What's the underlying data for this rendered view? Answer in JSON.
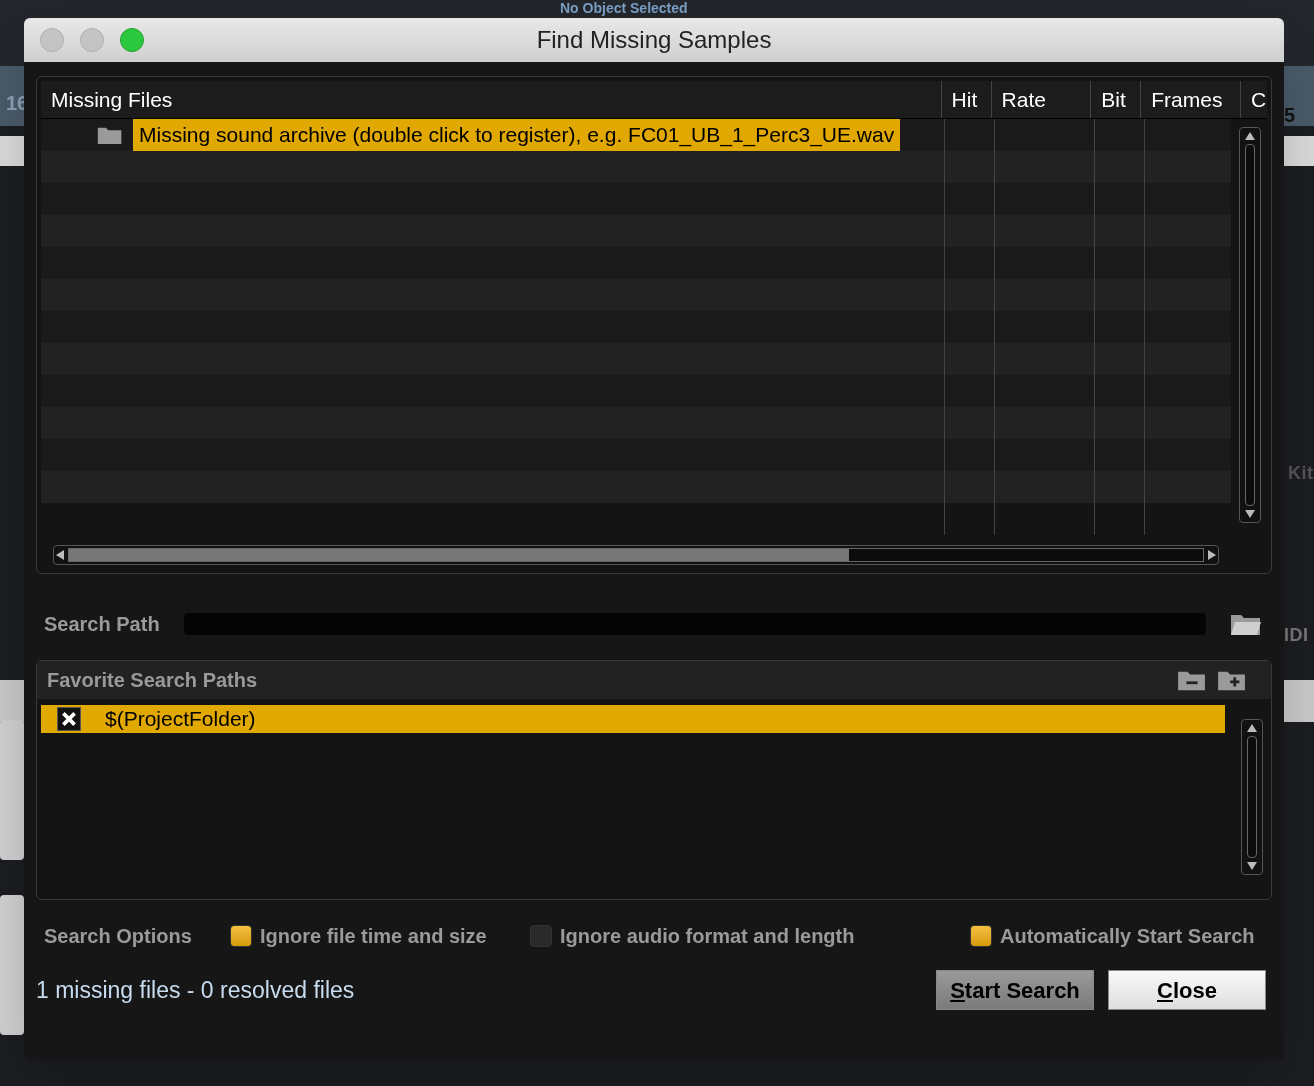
{
  "background": {
    "header_title": "No Object Selected",
    "fragments": [
      {
        "kind": "number",
        "text": "16"
      },
      {
        "kind": "number",
        "text": "5"
      },
      {
        "kind": "label",
        "text": "Kit"
      },
      {
        "kind": "label",
        "text": "IDI"
      }
    ]
  },
  "window": {
    "title": "Find Missing Samples"
  },
  "missing_files": {
    "columns": [
      "Missing Files",
      "Hit",
      "Rate",
      "Bit",
      "Frames",
      "C"
    ],
    "rows": [
      {
        "name": "Missing sound archive (double click to register), e.g. FC01_UB_1_Perc3_UE.wav",
        "selected": true
      }
    ]
  },
  "search_path": {
    "label": "Search Path"
  },
  "favorites": {
    "title": "Favorite Search Paths",
    "items": [
      {
        "path": "$(ProjectFolder)",
        "checked": true,
        "selected": true
      }
    ]
  },
  "search_options": {
    "label": "Search Options",
    "options": [
      {
        "label": "Ignore file time and size",
        "checked": true
      },
      {
        "label": "Ignore audio format and length",
        "checked": false
      },
      {
        "label": "Automatically Start Search",
        "checked": true
      }
    ]
  },
  "status": "1 missing files - 0 resolved files",
  "buttons": [
    {
      "mnemonic": "S",
      "rest": "tart Search",
      "kind": "secondary"
    },
    {
      "mnemonic": "C",
      "rest": "lose",
      "kind": "primary"
    }
  ]
}
